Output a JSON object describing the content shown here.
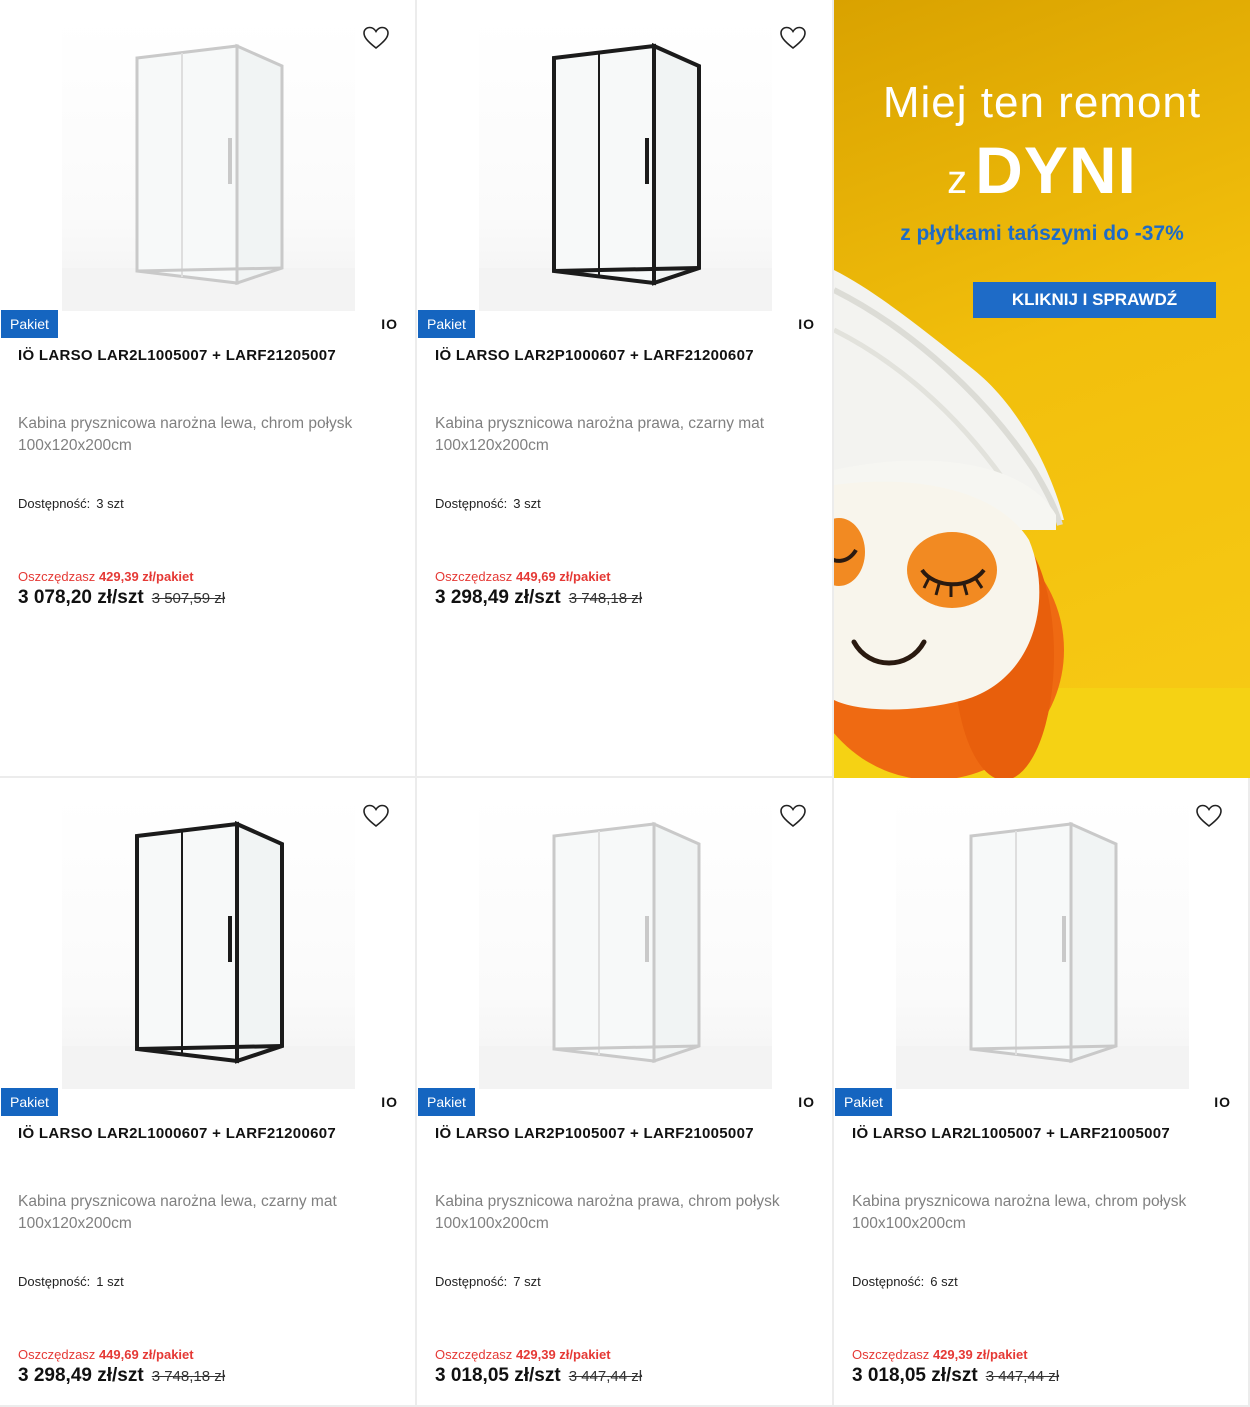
{
  "products": [
    {
      "badge": "Pakiet",
      "brand": "IO",
      "title": "IÖ LARSO LAR2L1005007 + LARF21205007",
      "desc_line1": "Kabina prysznicowa narożna lewa, chrom połysk",
      "desc_line2": "100x120x200cm",
      "availability_label": "Dostępność:",
      "availability_value": "3 szt",
      "save_label": "Oszczędzasz",
      "save_amount": "429,39 zł/pakiet",
      "price": "3 078,20 zł/szt",
      "old_price": "3 507,59 zł",
      "frame": "chrome"
    },
    {
      "badge": "Pakiet",
      "brand": "IO",
      "title": "IÖ LARSO LAR2P1000607 + LARF21200607",
      "desc_line1": "Kabina prysznicowa narożna prawa, czarny mat",
      "desc_line2": "100x120x200cm",
      "availability_label": "Dostępność:",
      "availability_value": "3 szt",
      "save_label": "Oszczędzasz",
      "save_amount": "449,69 zł/pakiet",
      "price": "3 298,49 zł/szt",
      "old_price": "3 748,18 zł",
      "frame": "black"
    },
    {
      "badge": "Pakiet",
      "brand": "IO",
      "title": "IÖ LARSO LAR2L1000607 + LARF21200607",
      "desc_line1": "Kabina prysznicowa narożna lewa, czarny mat",
      "desc_line2": "100x120x200cm",
      "availability_label": "Dostępność:",
      "availability_value": "1 szt",
      "save_label": "Oszczędzasz",
      "save_amount": "449,69 zł/pakiet",
      "price": "3 298,49 zł/szt",
      "old_price": "3 748,18 zł",
      "frame": "black"
    },
    {
      "badge": "Pakiet",
      "brand": "IO",
      "title": "IÖ LARSO LAR2P1005007 + LARF21005007",
      "desc_line1": "Kabina prysznicowa narożna prawa, chrom połysk",
      "desc_line2": "100x100x200cm",
      "availability_label": "Dostępność:",
      "availability_value": "7 szt",
      "save_label": "Oszczędzasz",
      "save_amount": "429,39 zł/pakiet",
      "price": "3 018,05 zł/szt",
      "old_price": "3 447,44 zł",
      "frame": "chrome"
    },
    {
      "badge": "Pakiet",
      "brand": "IO",
      "title": "IÖ LARSO LAR2L1005007 + LARF21005007",
      "desc_line1": "Kabina prysznicowa narożna lewa, chrom połysk",
      "desc_line2": "100x100x200cm",
      "availability_label": "Dostępność:",
      "availability_value": "6 szt",
      "save_label": "Oszczędzasz",
      "save_amount": "429,39 zł/pakiet",
      "price": "3 018,05 zł/szt",
      "old_price": "3 447,44 zł",
      "frame": "chrome"
    }
  ],
  "banner": {
    "line1": "Miej ten remont",
    "line2_prefix": "z",
    "line2_main": "DYNI",
    "line3": "z płytkami tańszymi do -37%",
    "cta": "KLIKNIJ I SPRAWDŹ"
  },
  "icons": {
    "favorite": "heart-outline-icon"
  },
  "colors": {
    "badge_bg": "#1565c0",
    "save_red": "#e53935",
    "banner_yellow": "#f2bf0c",
    "banner_blue": "#1e6bc7",
    "pumpkin": "#ef6a12"
  }
}
